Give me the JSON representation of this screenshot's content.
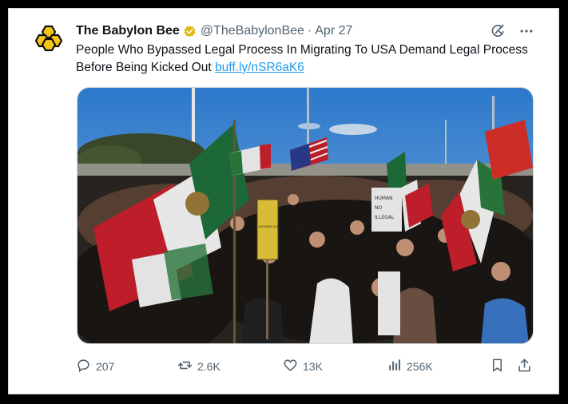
{
  "tweet": {
    "author_name": "The Babylon Bee",
    "handle": "@TheBabylonBee",
    "separator": "·",
    "date": "Apr 27",
    "text": "People Who Bypassed Legal Process In Migrating To USA Demand Legal Process Before Being Kicked Out",
    "link": "buff.ly/nSR6aK6"
  },
  "media": {
    "sign_text": "NOTHING ILLEGAL ABOUT BEING HUMAN",
    "protest_sign_words": [
      "HUMAN",
      "NO",
      "ILLEGAL"
    ]
  },
  "actions": {
    "replies": "207",
    "reposts": "2.6K",
    "likes": "13K",
    "views": "256K"
  },
  "icons": {
    "avatar": "bee-logo-icon",
    "verified": "verified-badge-icon",
    "grok": "grok-icon",
    "more": "more-options-icon",
    "reply": "reply-icon",
    "repost": "repost-icon",
    "like": "heart-icon",
    "views": "views-icon",
    "bookmark": "bookmark-icon",
    "share": "share-icon"
  },
  "colors": {
    "text": "#0f1419",
    "secondary": "#536471",
    "link": "#1d9bf0",
    "verified_gold": "#e2b719",
    "bee_yellow": "#f5c518"
  }
}
